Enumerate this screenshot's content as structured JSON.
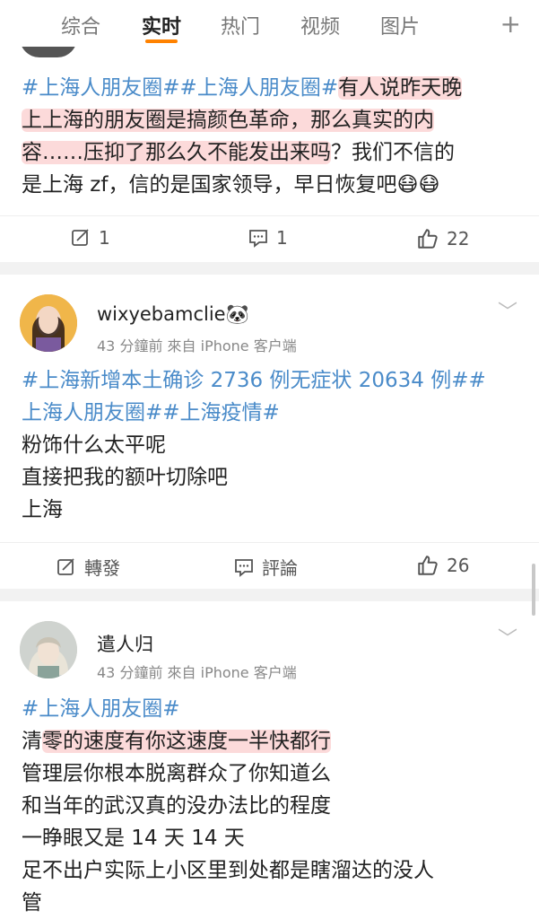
{
  "tabs": [
    {
      "label": "综合"
    },
    {
      "label": "实时"
    },
    {
      "label": "热门"
    },
    {
      "label": "视频"
    },
    {
      "label": "图片"
    }
  ],
  "add_tab_label": "+",
  "post1": {
    "line1_tag": "#上海人朋友圈##上海人朋友圈#",
    "line1_hl": "有人说昨天晚",
    "line2_hl": "上上海的朋友圈是搞颜色革命，那么真实的内",
    "line3_hl": "容……压抑了那么久不能发出来吗",
    "line3_rest": "？我们不信的",
    "line4": "是上海 zf，信的是国家领导，早日恢复吧😷😷",
    "repost_count": "1",
    "comment_count": "1",
    "like_count": "22"
  },
  "post2": {
    "username": "wixyebamclie🐼",
    "meta": "43 分鐘前  來自 iPhone 客户端",
    "line1": "#上海新增本土确诊 2736 例无症状 20634 例##",
    "line2": "上海人朋友圈##上海疫情#",
    "line3": "粉饰什么太平呢",
    "line4": "直接把我的额叶切除吧",
    "line5": "上海",
    "repost_label": "轉發",
    "comment_label": "評論",
    "like_count": "26"
  },
  "post3": {
    "username": "遣人归",
    "meta": "43 分鐘前  來自 iPhone 客户端",
    "line1": "#上海人朋友圈#",
    "line2_pre": "清",
    "line2_hl": "零的速度有你这速度一半快都行",
    "line3": "管理层你根本脱离群众了你知道么",
    "line4": "和当年的武汉真的没办法比的程度",
    "line5": "一睁眼又是 14 天 14 天",
    "line6": "足不出户实际上小区里到处都是瞎溜达的没人",
    "line7": "管"
  }
}
